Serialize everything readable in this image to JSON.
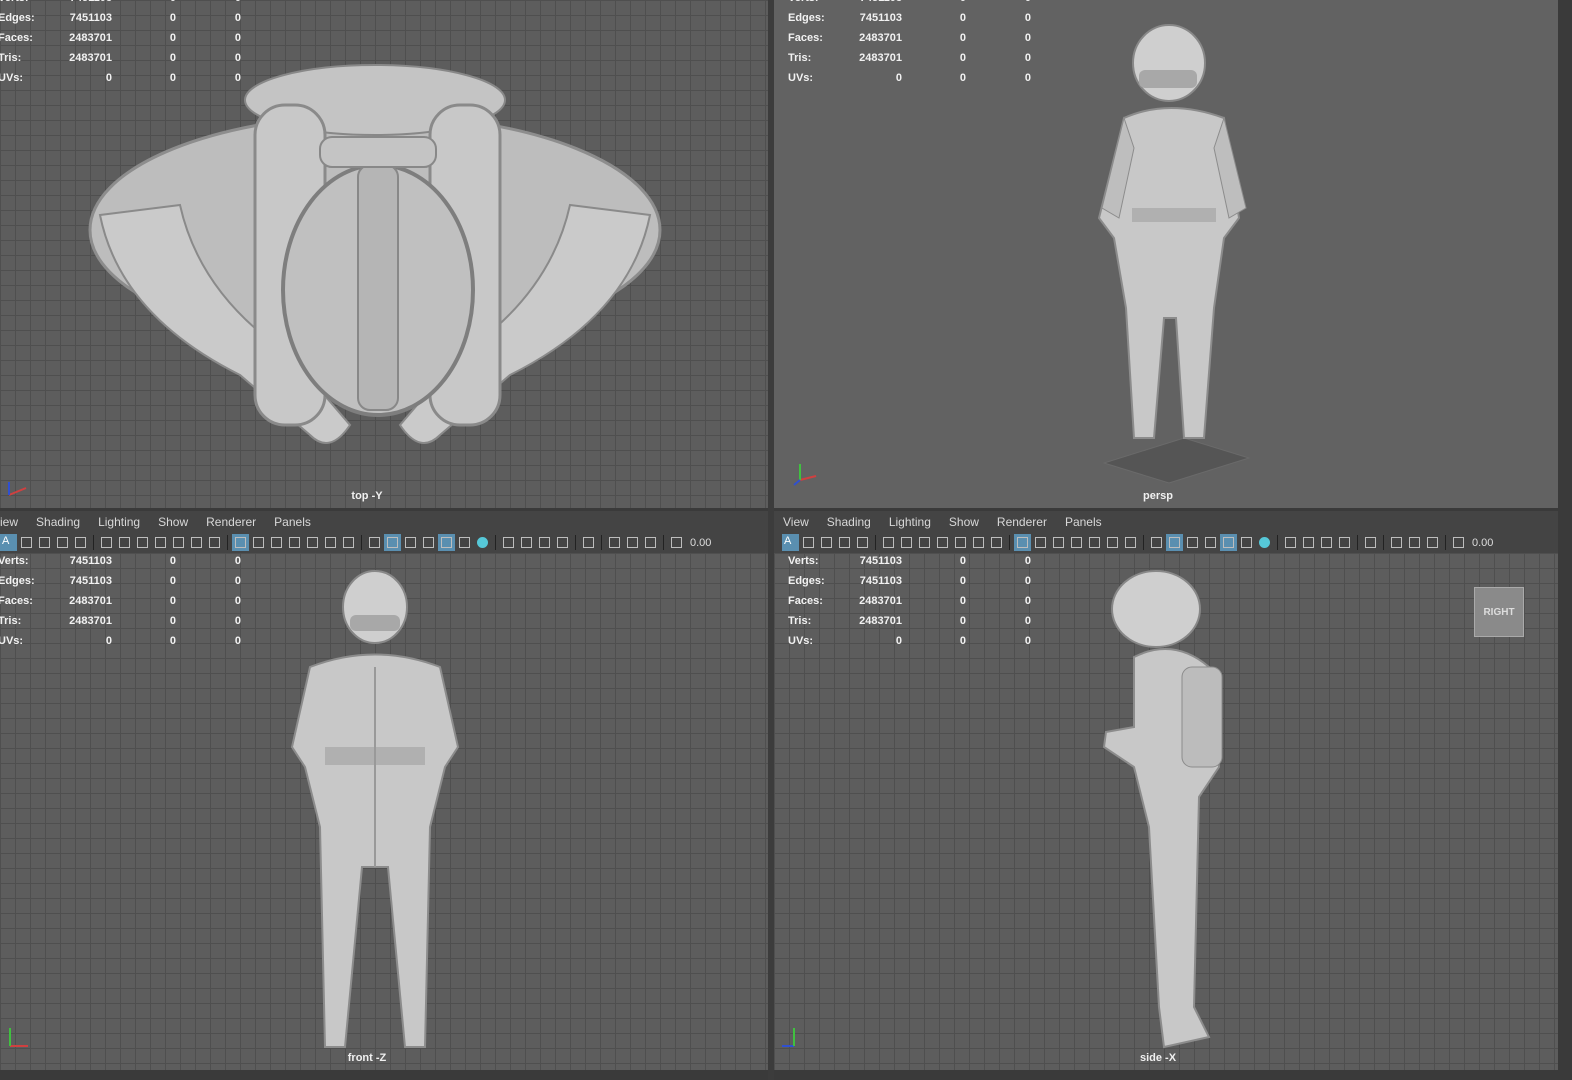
{
  "panel_menu": [
    "View",
    "Shading",
    "Lighting",
    "Show",
    "Renderer",
    "Panels"
  ],
  "panel_menu_left": [
    "iew",
    "Shading",
    "Lighting",
    "Show",
    "Renderer",
    "Panels"
  ],
  "hud": {
    "rows": [
      {
        "label": "Verts:",
        "v1": "7451103",
        "v2": "0",
        "v3": "0"
      },
      {
        "label": "Edges:",
        "v1": "7451103",
        "v2": "0",
        "v3": "0"
      },
      {
        "label": "Faces:",
        "v1": "2483701",
        "v2": "0",
        "v3": "0"
      },
      {
        "label": "Tris:",
        "v1": "2483701",
        "v2": "0",
        "v3": "0"
      },
      {
        "label": "UVs:",
        "v1": "0",
        "v2": "0",
        "v3": "0"
      }
    ]
  },
  "viewports": {
    "top": {
      "camera": "top -Y"
    },
    "persp": {
      "camera": "persp"
    },
    "front": {
      "camera": "front -Z"
    },
    "side": {
      "camera": "side -X",
      "view_cube": "RIGHT"
    }
  },
  "toolbar": {
    "field_value": "0.00",
    "a_icon": "A"
  },
  "colors": {
    "accent": "#5a8fb0",
    "cyan": "#56c8d8",
    "viewport": "#5d5d5d",
    "model": "#c9c9c9"
  }
}
